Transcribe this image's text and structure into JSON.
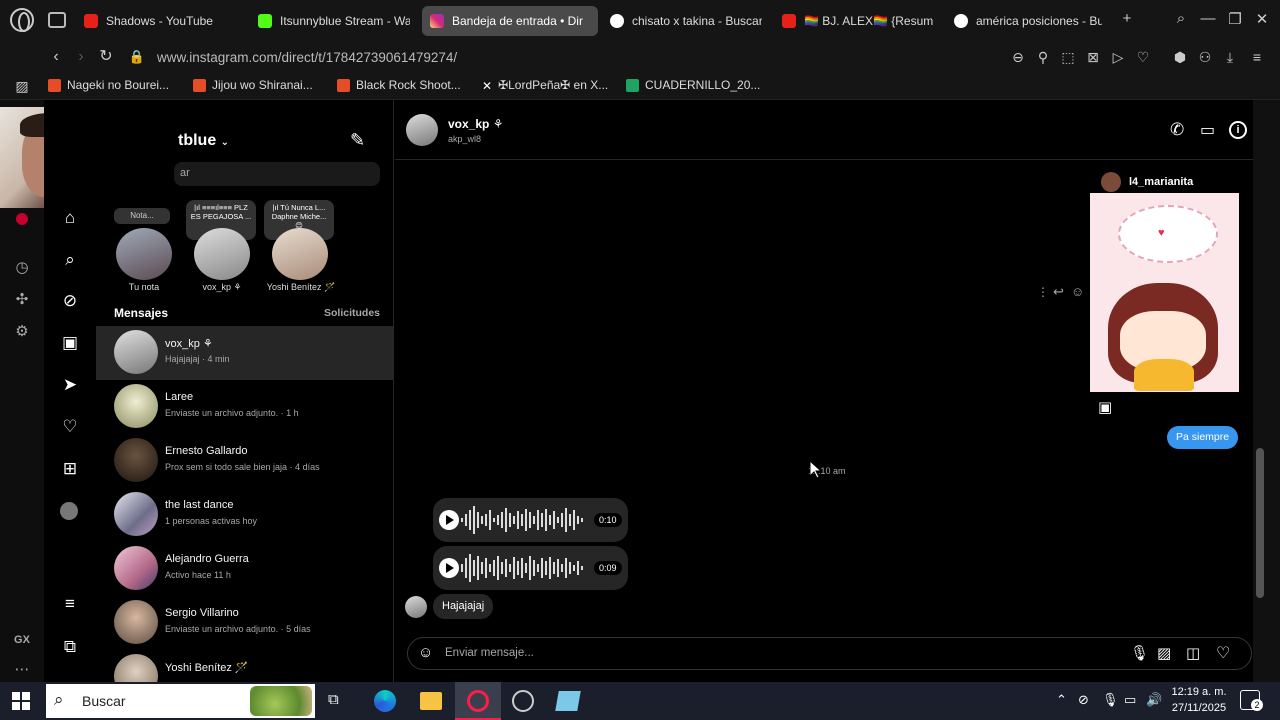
{
  "browser": {
    "tabs": [
      {
        "title": "Shadows - YouTube",
        "icon": "youtube-icon",
        "color": "#e62117"
      },
      {
        "title": "Itsunnyblue Stream - Wa",
        "icon": "kick-icon",
        "color": "#53fc18"
      },
      {
        "title": "Bandeja de entrada • Dir",
        "icon": "instagram-icon",
        "color": "#d6249f",
        "active": true
      },
      {
        "title": "chisato x takina - Buscar",
        "icon": "google-icon",
        "color": "#ffffff"
      },
      {
        "title": "🏳️‍🌈 BJ. ALEX🏳️‍🌈 {Resum",
        "icon": "youtube-icon",
        "color": "#e62117"
      },
      {
        "title": "américa posiciones - Bu",
        "icon": "google-icon",
        "color": "#ffffff"
      }
    ],
    "url": "www.instagram.com/direct/t/17842739061479274/",
    "bookmarks": [
      {
        "title": "Nageki no Bourei...",
        "color": "#e54d26"
      },
      {
        "title": "Jijou wo Shiranai...",
        "color": "#e54d26"
      },
      {
        "title": "Black Rock Shoot...",
        "color": "#e54d26"
      },
      {
        "title": "✠LordPeña✠ en X...",
        "color": "#ffffff"
      },
      {
        "title": "CUADERNILLO_20...",
        "color": "#1ea362"
      }
    ]
  },
  "sidebar": {
    "username_partial": "tblue",
    "search_placeholder": "ar",
    "notes": [
      {
        "bubble": "Nota...",
        "label": "Tu nota"
      },
      {
        "bubble": "|ıl ≡≡≡ıl≡≡≡ PLZ ES PEGAJOSA ...",
        "label": "vox_kp ⚘"
      },
      {
        "bubble": "|ıl Tú Nunca L... Daphne Miche... 😊",
        "label": "Yoshi Benítez 🪄"
      }
    ],
    "messages_heading": "Mensajes",
    "requests_label": "Solicitudes"
  },
  "conversations": [
    {
      "name": "vox_kp ⚘",
      "preview": "Hajajajaj · 4 min",
      "color": "#888"
    },
    {
      "name": "Laree",
      "preview": "Enviaste un archivo adjunto. · 1 h",
      "color": "#cfcfa8"
    },
    {
      "name": "Ernesto Gallardo",
      "preview": "Prox sem si todo sale bien jaja · 4 días",
      "color": "#5b4a3a"
    },
    {
      "name": "the last dance",
      "preview": "1 personas activas hoy",
      "color": "#6d6d8a"
    },
    {
      "name": "Alejandro Guerra",
      "preview": "Activo hace 11 h",
      "color": "#b56b8a"
    },
    {
      "name": "Sergio Villarino",
      "preview": "Enviaste un archivo adjunto. · 5 días",
      "color": "#8a8a8a"
    },
    {
      "name": "Yoshi Benítez 🪄",
      "preview": "",
      "color": "#9a9a9a"
    }
  ],
  "chat": {
    "contact_name": "vox_kp ⚘",
    "contact_handle": "akp_wl8",
    "shared_post_user": "l4_marianita",
    "sent_message": "Pa siempre",
    "timestamp": "12:10 am",
    "voice_messages": [
      {
        "duration": "0:10"
      },
      {
        "duration": "0:09"
      }
    ],
    "received_message": "Hajajajaj",
    "input_placeholder": "Enviar mensaje..."
  },
  "taskbar": {
    "search_placeholder": "Buscar",
    "time": "12:19 a. m.",
    "date": "27/11/2025",
    "notification_count": "2"
  }
}
